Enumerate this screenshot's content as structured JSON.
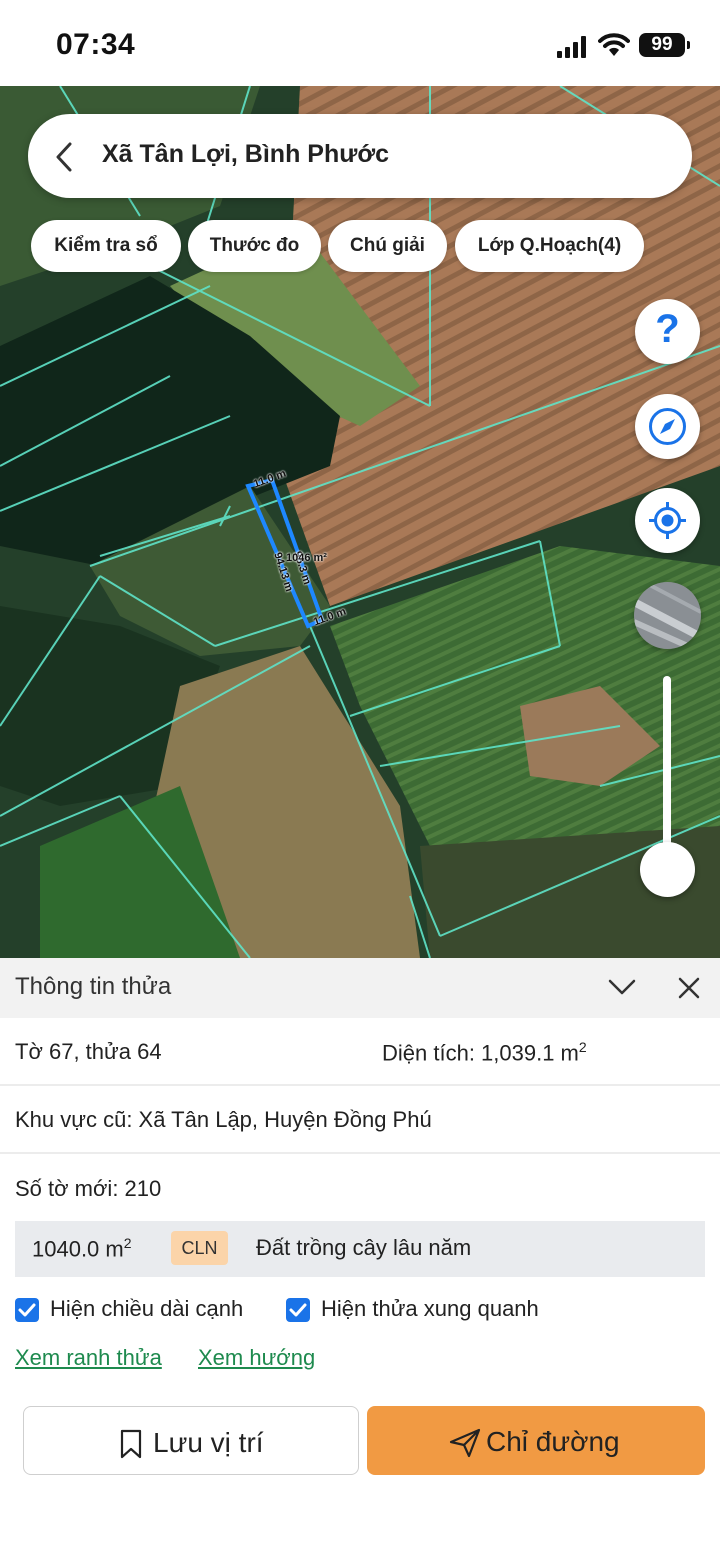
{
  "status_bar": {
    "time": "07:34",
    "battery": "99"
  },
  "search": {
    "title": "Xã Tân Lợi, Bình Phước"
  },
  "chips": [
    {
      "label": "Kiểm tra sổ"
    },
    {
      "label": "Thước đo"
    },
    {
      "label": "Chú giải"
    },
    {
      "label": "Lớp Q.Hoạch(4)"
    }
  ],
  "map": {
    "edge_top": "11.0 m",
    "edge_bottom": "11.0 m",
    "edge_left": "94.13 m",
    "edge_right": "95.3 m",
    "area_label": "1046 m²",
    "help_glyph": "?",
    "parcel_color": "#1e88ff",
    "boundary_color": "#5fe3c8"
  },
  "panel": {
    "title": "Thông tin thửa",
    "sheet_parcel": "Tờ 67, thửa 64",
    "area_prefix": "Diện tích: 1,039.1 m",
    "area_sup": "2",
    "old_region": "Khu vực cũ: Xã Tân Lập, Huyện Đồng Phú",
    "new_sheet": "Số tờ mới: 210",
    "land_area": "1040.0 m",
    "land_area_sup": "2",
    "land_code": "CLN",
    "land_type": "Đất trồng cây lâu năm",
    "checkbox_edge_length": "Hiện chiều dài cạnh",
    "checkbox_neighbors": "Hiện thửa xung quanh",
    "link_boundary": "Xem ranh thửa",
    "link_direction": "Xem hướng"
  },
  "actions": {
    "save_label": "Lưu vị trí",
    "route_label": "Chỉ đường"
  },
  "colors": {
    "accent_orange": "#f19a43",
    "link_green": "#1e8a4e",
    "checkbox_blue": "#1a73e8",
    "badge_bg": "#fbd4a9"
  }
}
